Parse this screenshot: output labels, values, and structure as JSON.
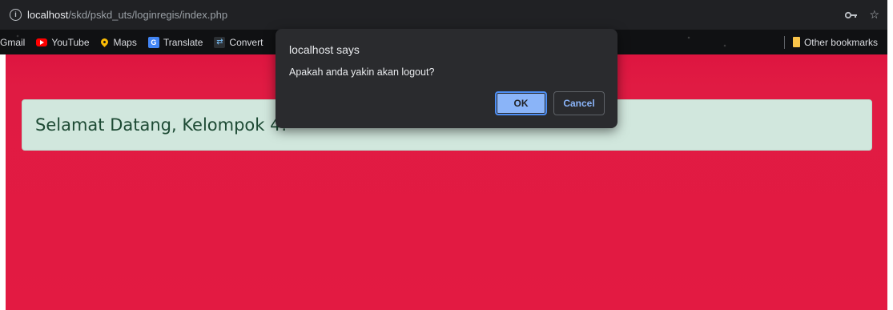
{
  "browser": {
    "url_host": "localhost",
    "url_path": "/skd/pskd_uts/loginregis/index.php",
    "icons": {
      "info": "info-icon",
      "key": "key-icon",
      "star": "star-icon"
    }
  },
  "bookmarks": {
    "items": [
      {
        "label": "Gmail",
        "icon": "none"
      },
      {
        "label": "YouTube",
        "icon": "youtube-icon"
      },
      {
        "label": "Maps",
        "icon": "maps-icon"
      },
      {
        "label": "Translate",
        "icon": "translate-icon"
      },
      {
        "label": "Convert",
        "icon": "convert-icon"
      }
    ],
    "other_label": "Other bookmarks"
  },
  "page": {
    "welcome_text": "Selamat Datang, Kelompok 4!",
    "background_color": "#e01b43",
    "alert_color": "#d1e7dd"
  },
  "dialog": {
    "title": "localhost says",
    "message": "Apakah anda yakin akan logout?",
    "ok_label": "OK",
    "cancel_label": "Cancel"
  }
}
